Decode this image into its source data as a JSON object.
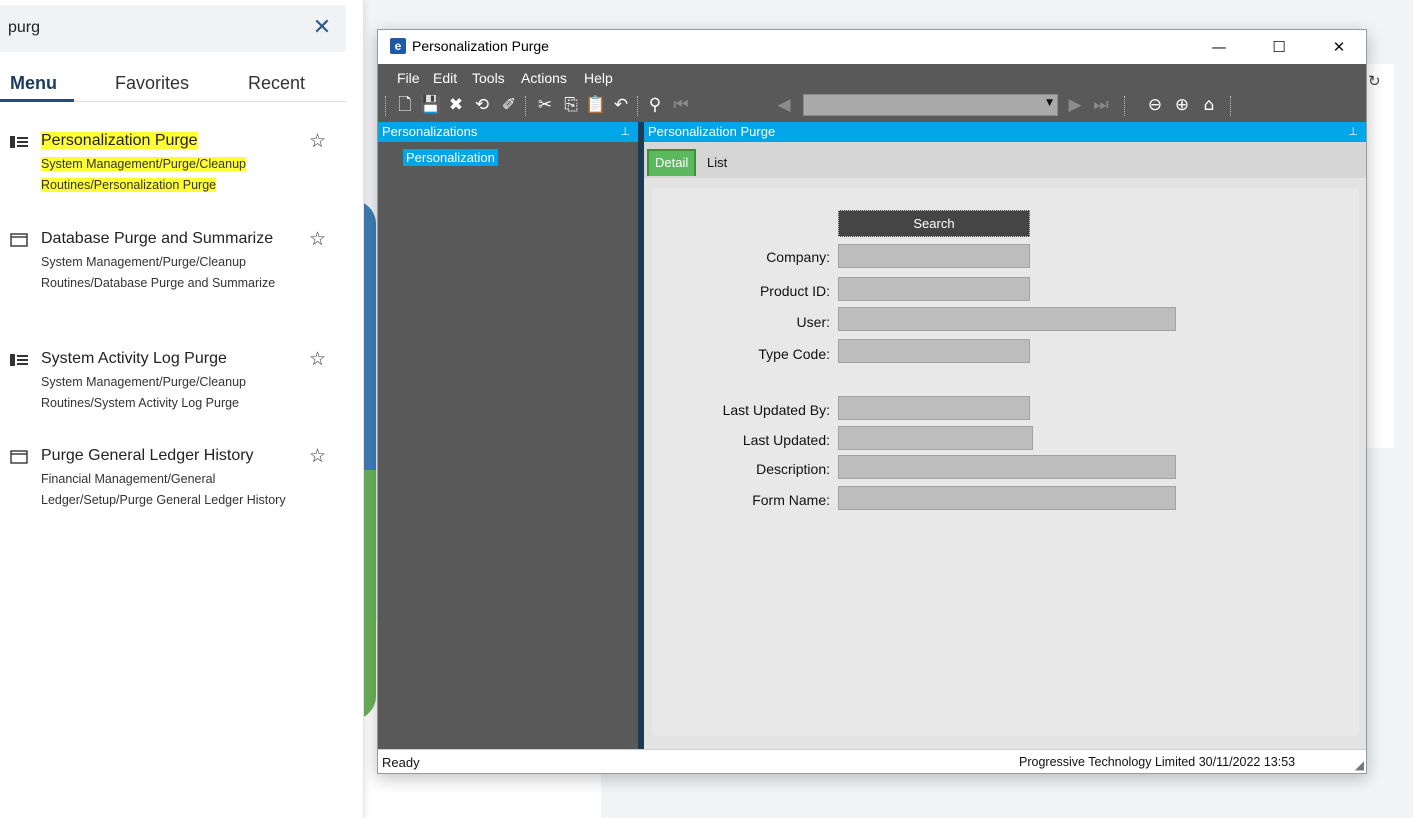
{
  "search": {
    "value": "purg"
  },
  "tabs": [
    "Menu",
    "Favorites",
    "Recent"
  ],
  "results": [
    {
      "title": "Personalization Purge",
      "path": "System Management/Purge/Cleanup Routines/Personalization Purge",
      "icon": "list-icon",
      "highlighted": true
    },
    {
      "title": "Database Purge and Summarize",
      "path": "System Management/Purge/Cleanup Routines/Database Purge and Summarize",
      "icon": "window-icon",
      "highlighted": false
    },
    {
      "title": "System Activity Log Purge",
      "path": "System Management/Purge/Cleanup Routines/System Activity Log Purge",
      "icon": "list-icon",
      "highlighted": false
    },
    {
      "title": "Purge General Ledger History",
      "path": "Financial Management/General Ledger/Setup/Purge General Ledger History",
      "icon": "window-icon",
      "highlighted": false
    }
  ],
  "window": {
    "title": "Personalization Purge",
    "menu": [
      "File",
      "Edit",
      "Tools",
      "Actions",
      "Help"
    ],
    "tree_header": "Personalizations",
    "tree_node": "Personalization",
    "form_header": "Personalization Purge",
    "form_tabs": [
      "Detail",
      "List"
    ],
    "search_button": "Search",
    "fields": {
      "company": "Company:",
      "product_id": "Product ID:",
      "user": "User:",
      "type_code": "Type Code:",
      "last_updated_by": "Last Updated By:",
      "last_updated": "Last Updated:",
      "description": "Description:",
      "form_name": "Form Name:"
    },
    "status": "Ready",
    "status_right": "Progressive Technology Limited  30/11/2022    13:53"
  },
  "colors": {
    "accent": "#00a6e7",
    "toolbar": "#595959",
    "highlight": "#ffff33",
    "active_tab": "#5cb85c"
  }
}
